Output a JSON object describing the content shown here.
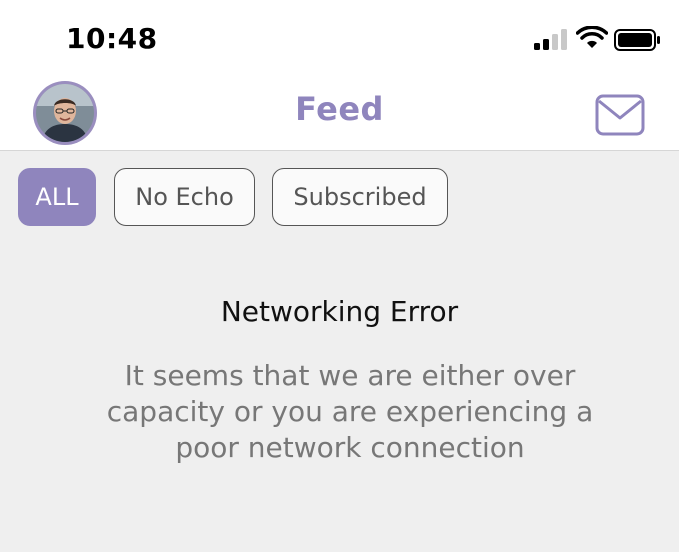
{
  "status_bar": {
    "time": "10:48",
    "icons": [
      "cellular-signal-icon",
      "wifi-icon",
      "battery-icon"
    ]
  },
  "header": {
    "title": "Feed",
    "avatar_icon": "user-avatar",
    "mail_icon": "mail-icon"
  },
  "filters": [
    {
      "label": "ALL",
      "active": true
    },
    {
      "label": "No Echo",
      "active": false
    },
    {
      "label": "Subscribed",
      "active": false
    }
  ],
  "error": {
    "title": "Networking Error",
    "message": "It seems that we are either over capacity or you are experiencing a poor network connection"
  },
  "colors": {
    "accent": "#8f85bd",
    "background": "#efefef",
    "header_background": "#ffffff"
  }
}
